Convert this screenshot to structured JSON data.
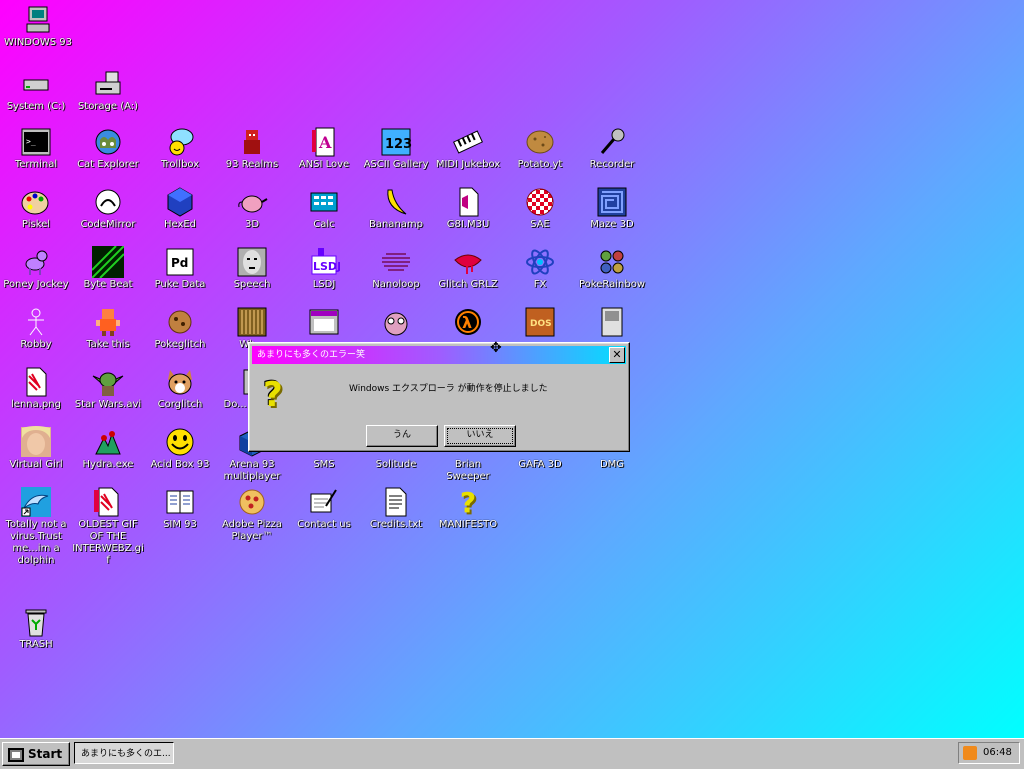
{
  "desktop_icons": [
    {
      "label": "WINDOWS 93",
      "icon": "computer-icon"
    },
    {
      "label": "System (C:)",
      "icon": "drive-icon"
    },
    {
      "label": "Storage (A:)",
      "icon": "floppy-drive-icon"
    },
    {
      "label": "Terminal",
      "icon": "terminal-icon"
    },
    {
      "label": "Cat Explorer",
      "icon": "cat-explorer-icon"
    },
    {
      "label": "Trollbox",
      "icon": "trollbox-icon"
    },
    {
      "label": "93 Realms",
      "icon": "realms-icon"
    },
    {
      "label": "ANSI Love",
      "icon": "ansi-icon"
    },
    {
      "label": "ASCII Gallery",
      "icon": "ascii-icon"
    },
    {
      "label": "MIDI Jukebox",
      "icon": "piano-icon"
    },
    {
      "label": "Potato.yt",
      "icon": "potato-icon"
    },
    {
      "label": "Recorder",
      "icon": "microphone-icon"
    },
    {
      "label": "Piskel",
      "icon": "palette-icon"
    },
    {
      "label": "CodeMirror",
      "icon": "codemirror-icon"
    },
    {
      "label": "HexEd",
      "icon": "hexed-icon"
    },
    {
      "label": "3D",
      "icon": "teapot-icon"
    },
    {
      "label": "Calc",
      "icon": "calculator-icon"
    },
    {
      "label": "Bananamp",
      "icon": "banana-icon"
    },
    {
      "label": "G8I.M3U",
      "icon": "playlist-icon"
    },
    {
      "label": "SAE",
      "icon": "ball-icon"
    },
    {
      "label": "Maze 3D",
      "icon": "maze-icon"
    },
    {
      "label": "Poney Jockey",
      "icon": "pony-icon"
    },
    {
      "label": "Byte Beat",
      "icon": "bytebeat-icon"
    },
    {
      "label": "Puke Data",
      "icon": "pd-icon"
    },
    {
      "label": "Speech",
      "icon": "speech-face-icon"
    },
    {
      "label": "LSDJ",
      "icon": "lsdj-icon"
    },
    {
      "label": "Nanoloop",
      "icon": "nanoloop-icon"
    },
    {
      "label": "Glitch GRLZ",
      "icon": "lips-icon"
    },
    {
      "label": "FX",
      "icon": "atom-icon"
    },
    {
      "label": "PokeRainbow",
      "icon": "pokemon-icon"
    },
    {
      "label": "Robby",
      "icon": "stickman-icon"
    },
    {
      "label": "Take this",
      "icon": "take-this-icon"
    },
    {
      "label": "Pokeglitch",
      "icon": "cookie-icon"
    },
    {
      "label": "Wh...",
      "icon": "piano-roll-icon"
    },
    {
      "label": "",
      "icon": "window-icon"
    },
    {
      "label": "",
      "icon": "owl-icon"
    },
    {
      "label": "",
      "icon": "half-life-icon"
    },
    {
      "label": "",
      "icon": "dos-box-icon"
    },
    {
      "label": "",
      "icon": "nes-icon"
    },
    {
      "label": "lenna.png",
      "icon": "image-file-icon"
    },
    {
      "label": "Star Wars.avi",
      "icon": "yoda-icon"
    },
    {
      "label": "Corglitch",
      "icon": "corgi-icon"
    },
    {
      "label": "Do... Man...",
      "icon": "doom-icon"
    },
    {
      "label": "...",
      "icon": "extra-icon"
    },
    {
      "label": "Virtual Girl",
      "icon": "girl-icon"
    },
    {
      "label": "Hydra.exe",
      "icon": "hydra-icon"
    },
    {
      "label": "Acid Box 93",
      "icon": "smiley-icon"
    },
    {
      "label": "Arena 93 multiplayer",
      "icon": "arena-icon"
    },
    {
      "label": "SMS",
      "icon": "sms-icon"
    },
    {
      "label": "Solitude",
      "icon": "cards-icon"
    },
    {
      "label": "Brian Sweeper",
      "icon": "mine-icon"
    },
    {
      "label": "GAFA 3D",
      "icon": "gafa-icon"
    },
    {
      "label": "DMG",
      "icon": "gameboy-icon"
    },
    {
      "label": "Totally not a virus.Trust me...im a dolphin",
      "icon": "dolphin-icon"
    },
    {
      "label": "OLDEST GIF OF THE INTERWEBZ.gif",
      "icon": "gif-file-icon"
    },
    {
      "label": "SIM 93",
      "icon": "sim-icon"
    },
    {
      "label": "Adobe Pizza Player™",
      "icon": "pizza-icon"
    },
    {
      "label": "Contact us",
      "icon": "contact-icon"
    },
    {
      "label": "Credits.txt",
      "icon": "text-file-icon"
    },
    {
      "label": "MANIFESTO",
      "icon": "question-icon"
    },
    {
      "label": "TRASH",
      "icon": "trash-icon"
    }
  ],
  "dialog": {
    "title": "あまりにも多くのエラー笑",
    "close_label": "✕",
    "message": "Windows エクスプローラ が動作を停止しました",
    "yes_label": "うん",
    "no_label": "いいえ",
    "icon": "question-mark-icon"
  },
  "taskbar": {
    "start_label": "Start",
    "task_label": "あまりにも多くのエ...",
    "clock": "06:48"
  },
  "colors": {
    "gradient_start": "#ff00ff",
    "gradient_end": "#00ffff",
    "window_face": "#c0c0c0"
  }
}
